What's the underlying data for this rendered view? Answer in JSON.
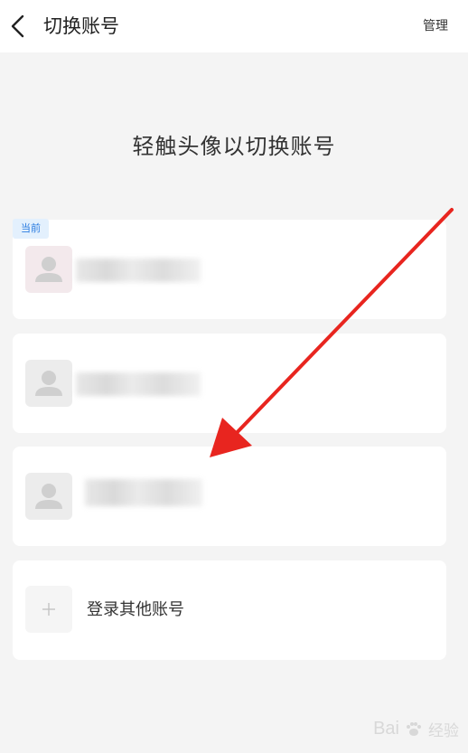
{
  "header": {
    "title": "切换账号",
    "manage_label": "管理"
  },
  "hint": "轻触头像以切换账号",
  "accounts": [
    {
      "badge": "当前"
    },
    {},
    {}
  ],
  "add_account": {
    "plus": "+",
    "label": "登录其他账号"
  },
  "watermark": {
    "brand": "Bai",
    "suffix": "经验"
  },
  "colors": {
    "accent_badge": "#2a7be0",
    "arrow": "#e8251f",
    "background": "#f4f4f4"
  }
}
